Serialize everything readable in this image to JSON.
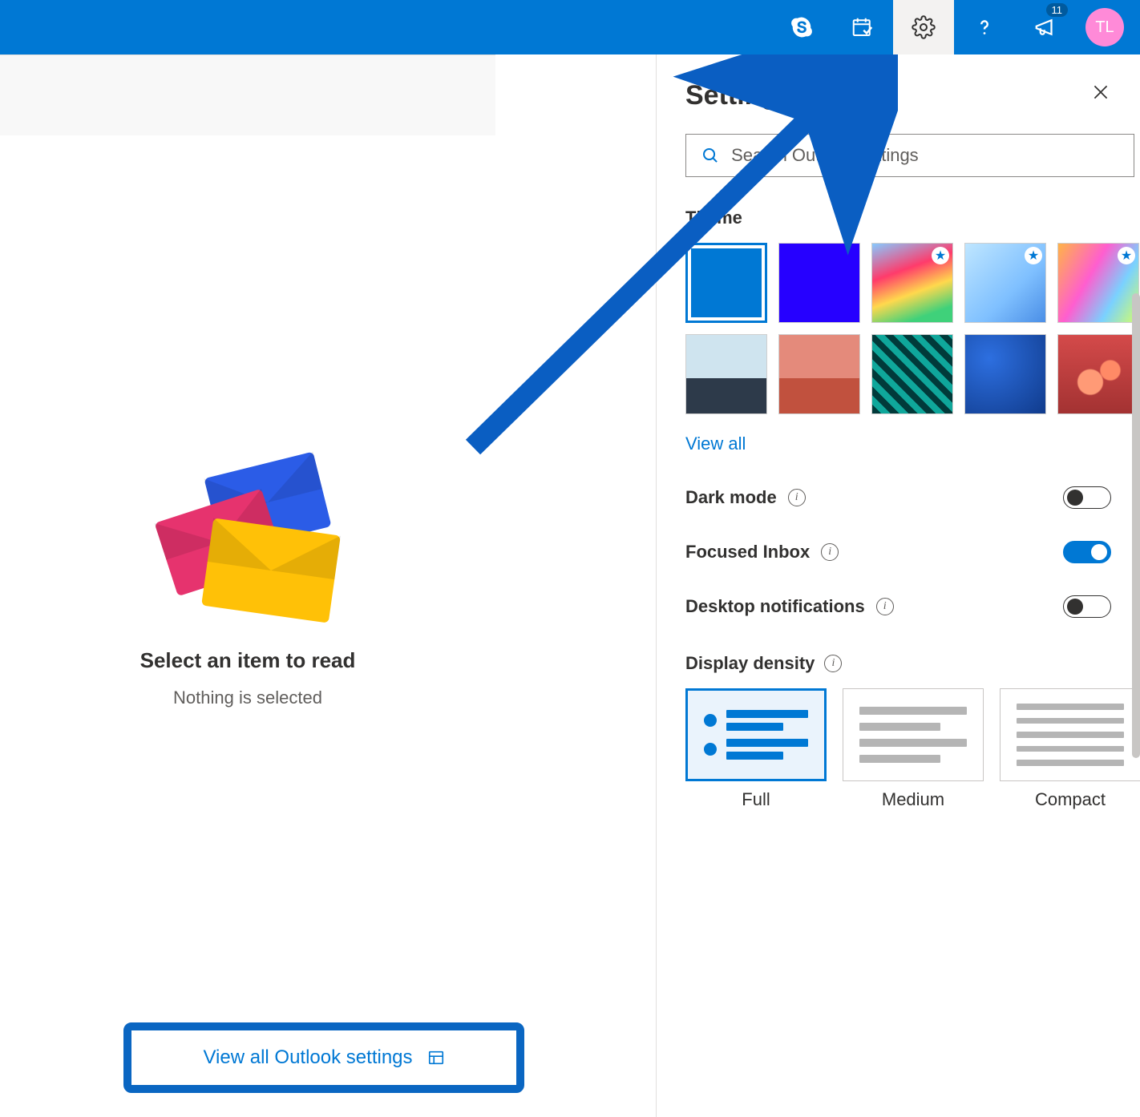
{
  "topbar": {
    "notification_count": "11",
    "avatar_initials": "TL"
  },
  "left": {
    "headline": "Select an item to read",
    "sub": "Nothing is selected"
  },
  "panel": {
    "title": "Settings",
    "search_placeholder": "Search Outlook settings",
    "theme_label": "Theme",
    "view_all": "View all",
    "toggles": {
      "dark": {
        "label": "Dark mode",
        "on": false
      },
      "focused": {
        "label": "Focused Inbox",
        "on": true
      },
      "desktop": {
        "label": "Desktop notifications",
        "on": false
      }
    },
    "density": {
      "label": "Display density",
      "options": [
        "Full",
        "Medium",
        "Compact"
      ],
      "selected": "Full"
    },
    "view_all_settings": "View all Outlook settings"
  }
}
